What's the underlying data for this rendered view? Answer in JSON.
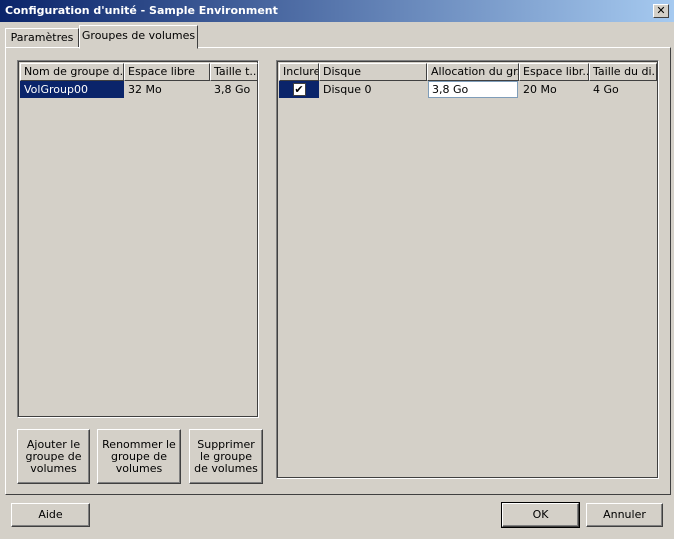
{
  "window": {
    "title": "Configuration d'unité - Sample Environment",
    "close_glyph": "✕"
  },
  "tabs": [
    {
      "label": "Paramètres",
      "active": false
    },
    {
      "label": "Groupes de volumes",
      "active": true
    }
  ],
  "left_table": {
    "columns": [
      "Nom de groupe d...",
      "Espace libre",
      "Taille t..."
    ],
    "rows": [
      {
        "name": "VolGroup00",
        "free": "32 Mo",
        "size": "3,8 Go",
        "selected": true
      }
    ]
  },
  "left_buttons": {
    "add": "Ajouter le\ngroupe de\nvolumes",
    "rename": "Renommer le\ngroupe de\nvolumes",
    "delete": "Supprimer\nle groupe\nde volumes"
  },
  "right_table": {
    "columns": [
      "Inclure",
      "Disque",
      "Allocation du gr...",
      "Espace libr...",
      "Taille du di..."
    ],
    "rows": [
      {
        "include": true,
        "check_glyph": "✔",
        "disk": "Disque 0",
        "allocation": "3,8 Go",
        "free": "20 Mo",
        "size": "4 Go"
      }
    ]
  },
  "footer": {
    "help": "Aide",
    "ok": "OK",
    "cancel": "Annuler"
  },
  "colors": {
    "face": "#d4d0c8",
    "selection": "#0a246a",
    "title_start": "#0a246a",
    "title_end": "#a6caf0"
  }
}
